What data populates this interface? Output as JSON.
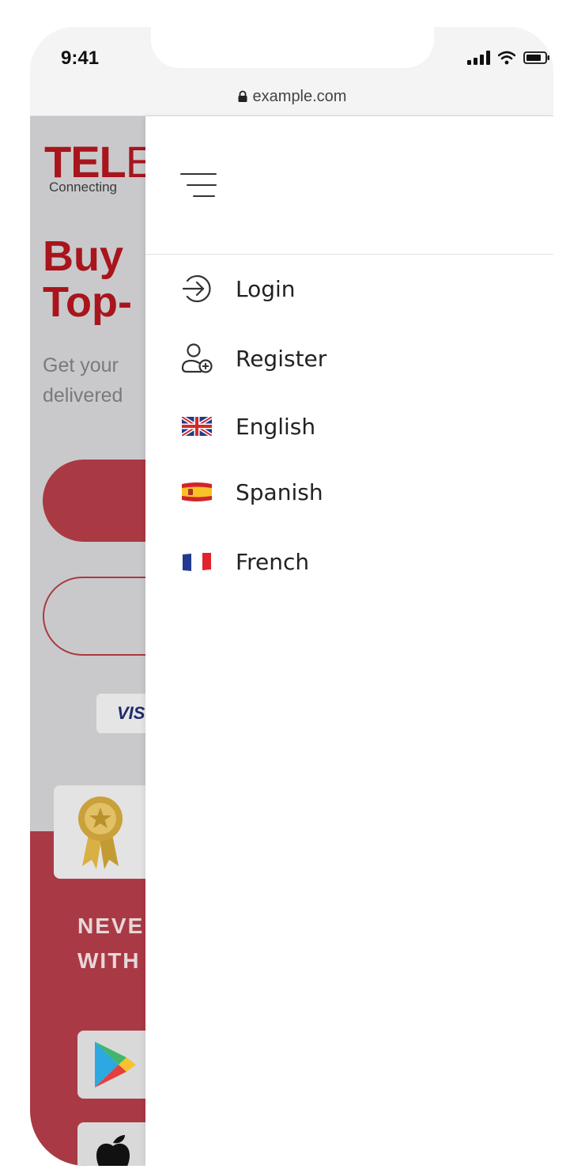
{
  "status_bar": {
    "time": "9:41"
  },
  "browser": {
    "url": "example.com"
  },
  "background_page": {
    "logo_bold": "TEL",
    "logo_thin": "E",
    "logo_tagline": "Connecting",
    "headline_line1": "Buy",
    "headline_line2": "Top-",
    "subtitle_line1": "Get your",
    "subtitle_line2": "delivered",
    "payment_badge": "VIS",
    "banner_line1": "NEVE",
    "banner_line2": "WITH"
  },
  "drawer": {
    "menu_icon": "hamburger-menu-icon",
    "items": [
      {
        "label": "Login",
        "icon": "login-icon"
      },
      {
        "label": "Register",
        "icon": "register-user-icon"
      },
      {
        "label": "English",
        "icon": "uk-flag-icon"
      },
      {
        "label": "Spanish",
        "icon": "spain-flag-icon"
      },
      {
        "label": "French",
        "icon": "france-flag-icon"
      }
    ]
  },
  "colors": {
    "brand_red": "#a8151c",
    "banner_red": "#a93a45",
    "drawer_bg": "#ffffff"
  }
}
